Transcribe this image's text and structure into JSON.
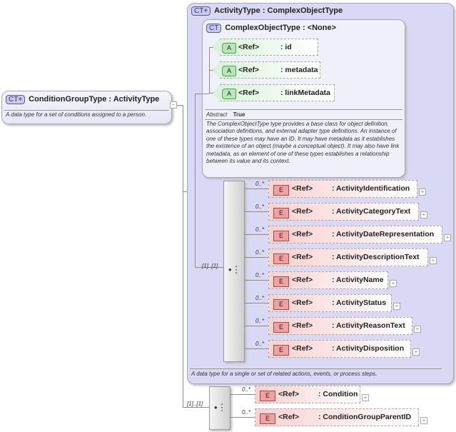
{
  "root": {
    "badge": "CT+",
    "title": "ConditionGroupType : ActivityType",
    "description": "A data type for a set of conditions assigned to a person."
  },
  "activity_type": {
    "badge": "CT+",
    "title": "ActivityType : ComplexObjectType",
    "description": "A data type for a single or set of related actions, events, or process steps.",
    "sequence_cardinality": "[1]..[1]",
    "elements": [
      {
        "card": "0..*",
        "ref": "<Ref>",
        "name": ": ActivityIdentification"
      },
      {
        "card": "0..*",
        "ref": "<Ref>",
        "name": ": ActivityCategoryText"
      },
      {
        "card": "0..*",
        "ref": "<Ref>",
        "name": ": ActivityDateRepresentation"
      },
      {
        "card": "0..*",
        "ref": "<Ref>",
        "name": ": ActivityDescriptionText"
      },
      {
        "card": "0..*",
        "ref": "<Ref>",
        "name": ": ActivityName"
      },
      {
        "card": "0..*",
        "ref": "<Ref>",
        "name": ": ActivityStatus"
      },
      {
        "card": "0..*",
        "ref": "<Ref>",
        "name": ": ActivityReasonText"
      },
      {
        "card": "0..*",
        "ref": "<Ref>",
        "name": ": ActivityDisposition"
      }
    ]
  },
  "complex_object_type": {
    "badge": "CT",
    "title": "ComplexObjectType : <None>",
    "abstract_label": "Abstract",
    "abstract_value": "True",
    "description": "The ComplexObjectType type provides a base class for object definition, association definitions, and external adapter type definitions. An instance of one of these types may have an ID. It may have metadata as it establishes the existence of an object (maybe a conceptual object). It may also have link metadata, as an element of one of these types establishes a relationship between its value and its context.",
    "attributes": [
      {
        "badge": "A",
        "ref": "<Ref>",
        "name": ": id"
      },
      {
        "badge": "A",
        "ref": "<Ref>",
        "name": ": metadata"
      },
      {
        "badge": "A",
        "ref": "<Ref>",
        "name": ": linkMetadata"
      }
    ]
  },
  "condition_group": {
    "sequence_cardinality": "[1]..[1]",
    "elements": [
      {
        "card": "0..*",
        "ref": "<Ref>",
        "name": ": Condition"
      },
      {
        "card": "0..*",
        "ref": "<Ref>",
        "name": ": ConditionGroupParentID"
      }
    ]
  },
  "icons": {
    "element": "E",
    "plus": "+",
    "minus": "−",
    "sequence": "•⋮"
  }
}
